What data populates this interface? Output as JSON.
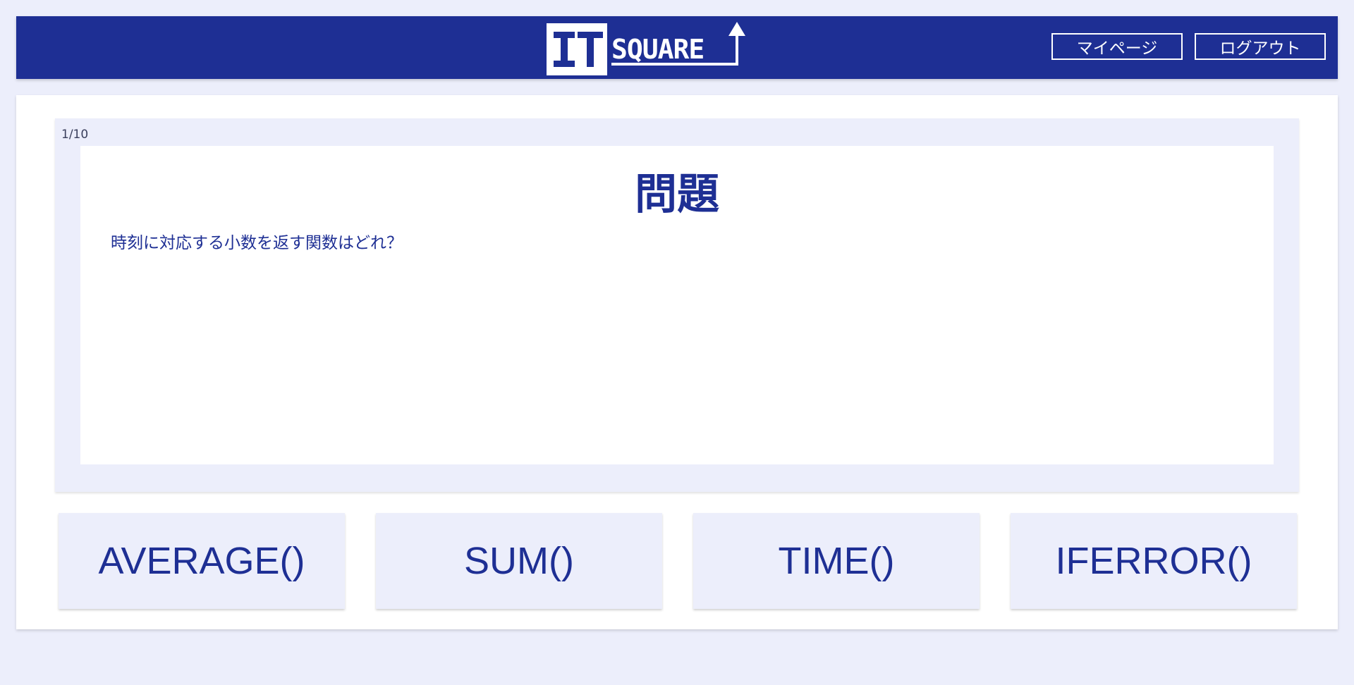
{
  "header": {
    "logo_text": "IT SQUARE",
    "nav": {
      "mypage_label": "マイページ",
      "logout_label": "ログアウト"
    }
  },
  "question": {
    "progress": "1/10",
    "title": "問題",
    "text": "時刻に対応する小数を返す関数はどれ？"
  },
  "answers": [
    {
      "label": "AVERAGE()"
    },
    {
      "label": "SUM()"
    },
    {
      "label": "TIME()"
    },
    {
      "label": "IFERROR()"
    }
  ],
  "colors": {
    "brand": "#1e2f94",
    "background": "#eceefb",
    "surface": "#ffffff"
  }
}
